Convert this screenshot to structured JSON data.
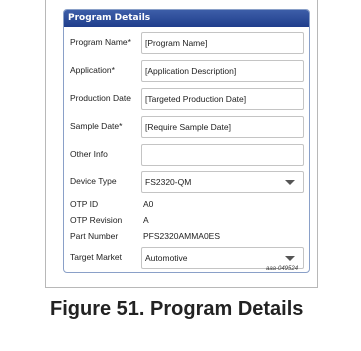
{
  "panel": {
    "title": "Program Details",
    "fields": {
      "program_name": {
        "label": "Program Name*",
        "value": "[Program Name]"
      },
      "application": {
        "label": "Application*",
        "value": "[Application Description]"
      },
      "production_date": {
        "label": "Production Date",
        "value": "[Targeted Production Date]"
      },
      "sample_date": {
        "label": "Sample Date*",
        "value": "[Require Sample Date]"
      },
      "other_info": {
        "label": "Other Info",
        "value": ""
      },
      "device_type": {
        "label": "Device Type",
        "value": "FS2320-QM"
      },
      "otp_id": {
        "label": "OTP ID",
        "value": "A0"
      },
      "otp_revision": {
        "label": "OTP Revision",
        "value": "A"
      },
      "part_number": {
        "label": "Part Number",
        "value": "PFS2320AMMA0ES"
      },
      "target_market": {
        "label": "Target Market",
        "value": "Automotive"
      }
    }
  },
  "figure": {
    "code": "aaa-049524",
    "caption": "Figure 51.  Program Details"
  }
}
